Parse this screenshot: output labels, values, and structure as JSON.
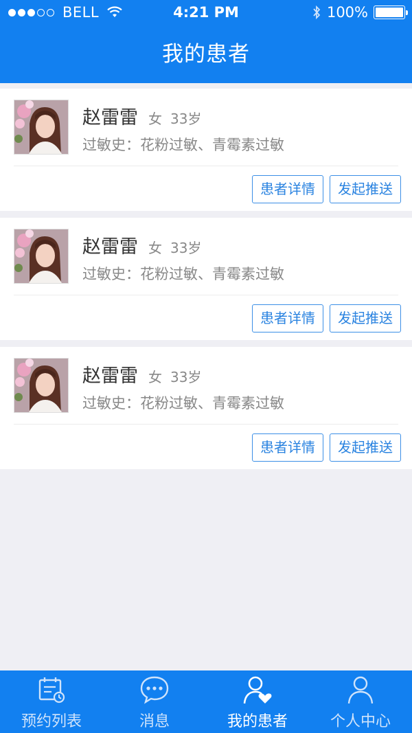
{
  "status_bar": {
    "carrier": "BELL",
    "time": "4:21 PM",
    "battery": "100%"
  },
  "header": {
    "title": "我的患者"
  },
  "patients": [
    {
      "name": "赵雷雷",
      "gender": "女",
      "age": "33岁",
      "allergy": "过敏史：花粉过敏、青霉素过敏",
      "detail_label": "患者详情",
      "push_label": "发起推送"
    },
    {
      "name": "赵雷雷",
      "gender": "女",
      "age": "33岁",
      "allergy": "过敏史：花粉过敏、青霉素过敏",
      "detail_label": "患者详情",
      "push_label": "发起推送"
    },
    {
      "name": "赵雷雷",
      "gender": "女",
      "age": "33岁",
      "allergy": "过敏史：花粉过敏、青霉素过敏",
      "detail_label": "患者详情",
      "push_label": "发起推送"
    }
  ],
  "tabbar": {
    "items": [
      {
        "label": "预约列表",
        "icon": "calendar-icon",
        "active": false
      },
      {
        "label": "消息",
        "icon": "chat-bubble-icon",
        "active": false
      },
      {
        "label": "我的患者",
        "icon": "patient-heart-icon",
        "active": true
      },
      {
        "label": "个人中心",
        "icon": "user-icon",
        "active": false
      }
    ]
  },
  "colors": {
    "primary": "#1280f0",
    "button_border": "#3a8ee6",
    "background": "#efeff4"
  }
}
